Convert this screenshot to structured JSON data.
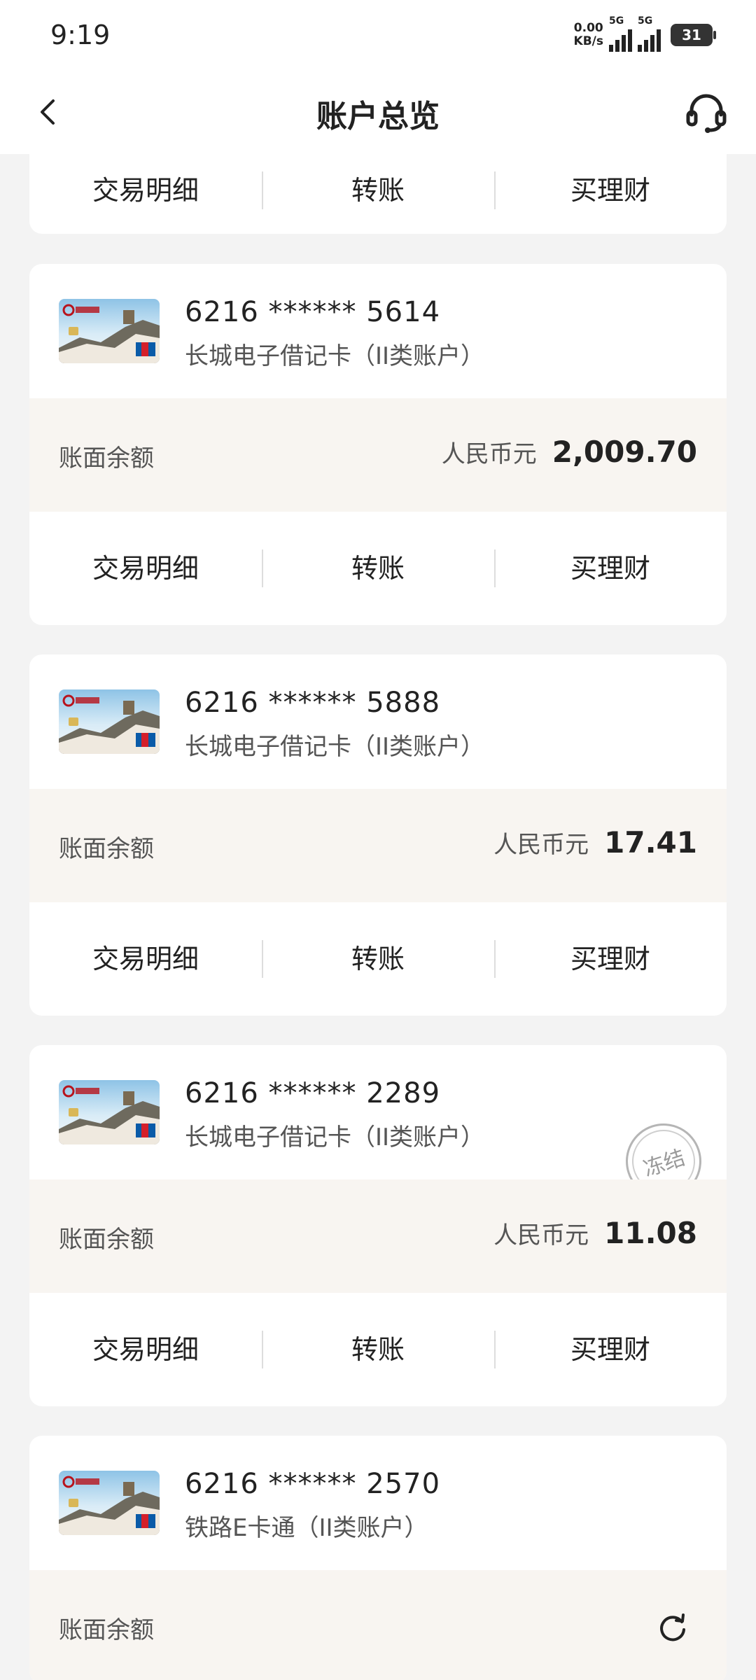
{
  "status_bar": {
    "time": "9:19",
    "net_speed_value": "0.00",
    "net_speed_unit": "KB/s",
    "signal_label_1": "5G",
    "signal_label_2": "5G",
    "battery": "31"
  },
  "header": {
    "title": "账户总览",
    "back_icon": "chevron-left-icon",
    "service_icon": "headset-icon"
  },
  "actions": {
    "details": "交易明细",
    "transfer": "转账",
    "wealth": "买理财"
  },
  "balance_label": "账面余额",
  "accounts": [
    {
      "number": "6216 ****** 5614",
      "type": "长城电子借记卡（II类账户）",
      "currency": "人民币元",
      "balance": "2,009.70"
    },
    {
      "number": "6216 ****** 5888",
      "type": "长城电子借记卡（II类账户）",
      "currency": "人民币元",
      "balance": "17.41"
    },
    {
      "number": "6216 ****** 2289",
      "type": "长城电子借记卡（II类账户）",
      "currency": "人民币元",
      "balance": "11.08",
      "stamp": "冻结"
    },
    {
      "number": "6216 ****** 2570",
      "type": "铁路E卡通（II类账户）",
      "refresh_icon": "refresh-icon"
    }
  ],
  "colors": {
    "page_bg": "#f3f3f3",
    "balance_bg": "#f8f5f1",
    "text_primary": "#222222",
    "text_secondary": "#555555"
  }
}
